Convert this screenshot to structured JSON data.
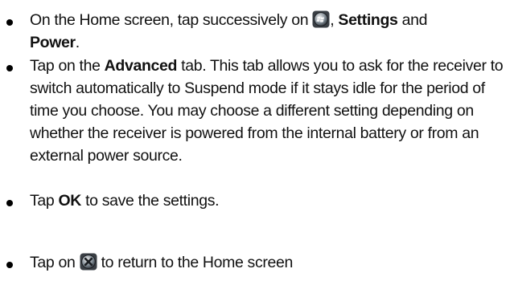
{
  "steps": [
    {
      "t1": "On the Home screen, tap successively on ",
      "icon": "windows-start-icon",
      "t2": ", ",
      "b1": "Settings",
      "t3": " and ",
      "b2": "Power",
      "t4": "."
    },
    {
      "t1": "Tap on the ",
      "b1": "Advanced",
      "t2": " tab. This tab allows you to ask for the receiver to switch automatically to Suspend mode if it stays idle for the period of time you choose. You may choose a different setting depending on whether the receiver is powered from the internal battery or from an external power source."
    },
    {
      "t1": "Tap ",
      "b1": "OK",
      "t2": " to save the settings."
    },
    {
      "t1": "Tap on ",
      "icon": "close-icon",
      "t2": " to return to the Home screen"
    }
  ]
}
